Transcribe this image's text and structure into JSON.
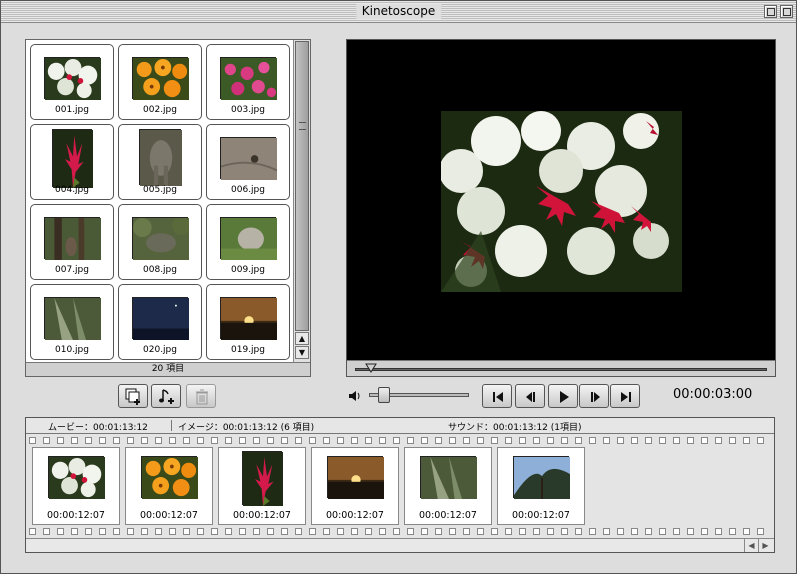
{
  "window": {
    "title": "Kinetoscope"
  },
  "browser": {
    "items": [
      {
        "name": "001.jpg",
        "thumb": "white-red-flowers"
      },
      {
        "name": "002.jpg",
        "thumb": "orange-flowers"
      },
      {
        "name": "003.jpg",
        "thumb": "pink-flowers"
      },
      {
        "name": "004.jpg",
        "thumb": "red-spiky-flower"
      },
      {
        "name": "005.jpg",
        "thumb": "elephant"
      },
      {
        "name": "006.jpg",
        "thumb": "elephant-skin"
      },
      {
        "name": "007.jpg",
        "thumb": "person-trees"
      },
      {
        "name": "008.jpg",
        "thumb": "elephant-bush"
      },
      {
        "name": "009.jpg",
        "thumb": "elephant-grass"
      },
      {
        "name": "010.jpg",
        "thumb": "forest-sunbeam"
      },
      {
        "name": "020.jpg",
        "thumb": "night-sky"
      },
      {
        "name": "019.jpg",
        "thumb": "sunset"
      }
    ],
    "count_label": "20 項目"
  },
  "toolbar": {
    "add_image_icon": "add-image-icon",
    "add_sound_icon": "add-sound-icon",
    "trash_icon": "trash-icon"
  },
  "player": {
    "timecode": "00:00:03:00",
    "position": 0.04,
    "volume": 0.15
  },
  "timeline": {
    "movie_label": "ムービー：00:01:13:12",
    "image_label": "イメージ：00:01:13:12 (6 項目)",
    "sound_label": "サウンド：00:01:13:12 (1項目)",
    "clips": [
      {
        "duration": "00:00:12:07",
        "thumb": "white-red-flowers"
      },
      {
        "duration": "00:00:12:07",
        "thumb": "orange-flowers"
      },
      {
        "duration": "00:00:12:07",
        "thumb": "red-spiky-flower"
      },
      {
        "duration": "00:00:12:07",
        "thumb": "sunset"
      },
      {
        "duration": "00:00:12:07",
        "thumb": "forest-sunbeam"
      },
      {
        "duration": "00:00:12:07",
        "thumb": "tree-sky"
      }
    ]
  }
}
